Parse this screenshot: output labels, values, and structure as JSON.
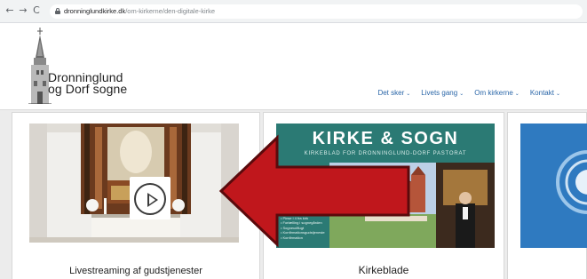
{
  "browser": {
    "url_domain": "dronninglundkirke.dk",
    "url_path": "/om-kirkerne/den-digitale-kirke"
  },
  "site": {
    "logo_line1": "Dronninglund",
    "logo_line2": "og Dorf sogne"
  },
  "nav": {
    "items": [
      {
        "label": "Det sker"
      },
      {
        "label": "Livets gang"
      },
      {
        "label": "Om kirkerne"
      },
      {
        "label": "Kontakt"
      }
    ]
  },
  "cards": [
    {
      "title": "Livestreaming af gudstjenester"
    },
    {
      "title": "Kirkeblade"
    }
  ],
  "magazine": {
    "title": "KIRKE & SOGN",
    "subtitle": "KIRKEBLAD FOR DRONNINGLUND-DORF PASTORAT",
    "list": [
      "• Nyt konfirmander",
      "• Pinse i 4 fra kirk",
      "• Fortælling i sognegården",
      "• Sogneudflugt",
      "• Konfirmationsgudstjeneste",
      "• Konfirmation"
    ]
  },
  "colors": {
    "nav_link": "#2a66a8",
    "arrow": "#c0171c",
    "magazine_bg": "#2b7a74",
    "band_bg": "#ececec"
  },
  "icons": {
    "play": "play-icon",
    "arrow": "arrow-left-annotation"
  }
}
